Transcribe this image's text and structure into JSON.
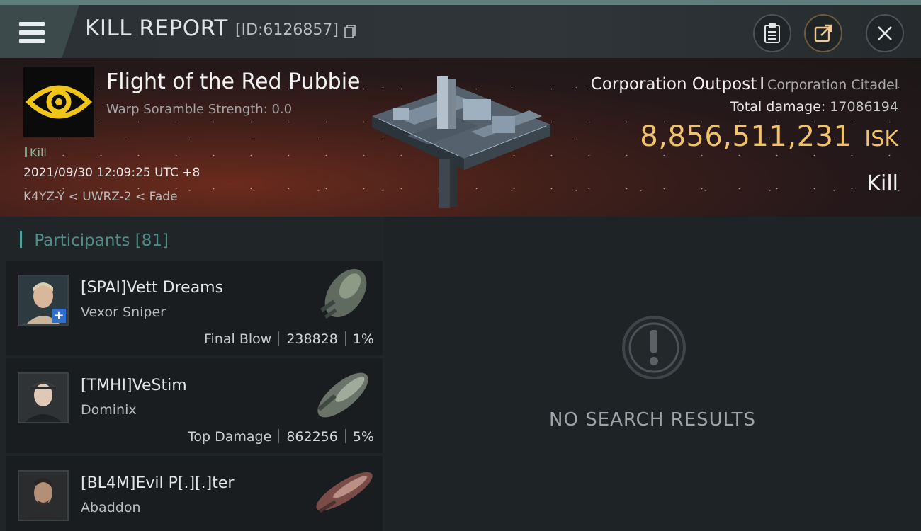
{
  "header": {
    "title": "KILL REPORT",
    "id_label": "[ID:6126857]"
  },
  "victim": {
    "name": "Flight of the Red Pubbie",
    "warp": "Warp Soramble Strength: 0.0",
    "kill_tag": "Kill",
    "datetime": "2021/09/30 12:09:25 UTC +8",
    "location": "K4YZ-Y < UWRZ-2 < Fade"
  },
  "summary": {
    "ship_type": "Corporation Outpost",
    "separator": "I",
    "ship_group": "Corporation Citadel",
    "total_damage_label": "Total damage:",
    "total_damage": "17086194",
    "isk_value": "8,856,511,231",
    "isk_unit": "ISK",
    "result": "Kill"
  },
  "participants": {
    "label": "Participants",
    "count": "[81]",
    "items": [
      {
        "name": "[SPAI]Vett Dreams",
        "ship": "Vexor Sniper",
        "role": "Final Blow",
        "damage": "238828",
        "percent": "1%"
      },
      {
        "name": "[TMHI]VeStim",
        "ship": "Dominix",
        "role": "Top Damage",
        "damage": "862256",
        "percent": "5%"
      },
      {
        "name": "[BL4M]Evil P[.][.]ter",
        "ship": "Abaddon",
        "role": "",
        "damage": "",
        "percent": ""
      }
    ]
  },
  "results": {
    "empty_text": "NO SEARCH RESULTS"
  },
  "colors": {
    "accent": "#5f7d7a",
    "isk": "#f2c26a",
    "participants": "#4f8d86"
  }
}
